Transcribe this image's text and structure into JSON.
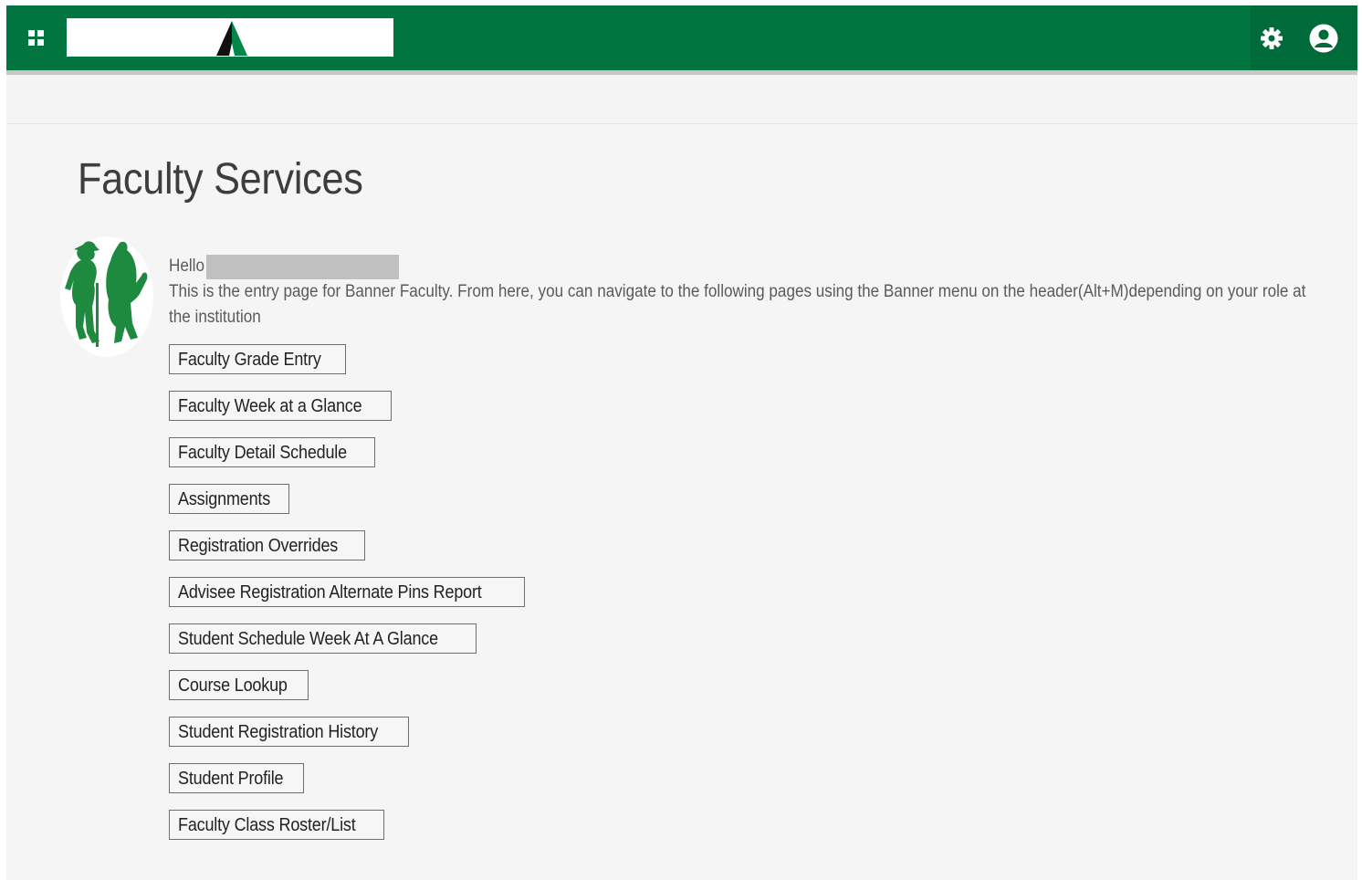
{
  "header": {
    "menu_icon": "grid-icon",
    "settings_icon": "gear-icon",
    "user_icon": "user-icon",
    "brand_color": "#007540"
  },
  "page": {
    "title": "Faculty Services",
    "greeting": "Hello",
    "intro": "This is the entry page for Banner Faculty. From here, you can navigate to the following pages using the Banner menu on the header(Alt+M)depending on your role at the institution"
  },
  "nav_buttons": [
    {
      "label": "Faculty Grade Entry"
    },
    {
      "label": "Faculty Week at a Glance"
    },
    {
      "label": "Faculty Detail Schedule"
    },
    {
      "label": "Assignments"
    },
    {
      "label": "Registration Overrides"
    },
    {
      "label": "Advisee Registration Alternate Pins Report"
    },
    {
      "label": "Student Schedule Week At A Glance"
    },
    {
      "label": "Course Lookup"
    },
    {
      "label": "Student Registration History"
    },
    {
      "label": "Student Profile"
    },
    {
      "label": "Faculty Class Roster/List"
    }
  ]
}
